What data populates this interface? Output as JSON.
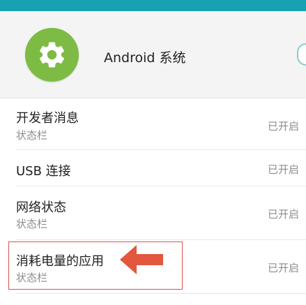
{
  "app": {
    "name": "Android 系统",
    "icon": "gear-icon",
    "icon_color": "#7dbb45"
  },
  "colors": {
    "status_bar": "#17a2b4",
    "highlight": "#d9534f",
    "arrow": "#e2573d"
  },
  "notifications": [
    {
      "title": "开发者消息",
      "subtitle": "状态栏",
      "status": "已开启"
    },
    {
      "title": "USB 连接",
      "subtitle": "",
      "status": "已开启"
    },
    {
      "title": "网络状态",
      "subtitle": "状态栏",
      "status": "已开启"
    },
    {
      "title": "消耗电量的应用",
      "subtitle": "状态栏",
      "status": "已开启"
    }
  ],
  "annotation": {
    "arrow_icon": "left-arrow-icon"
  }
}
